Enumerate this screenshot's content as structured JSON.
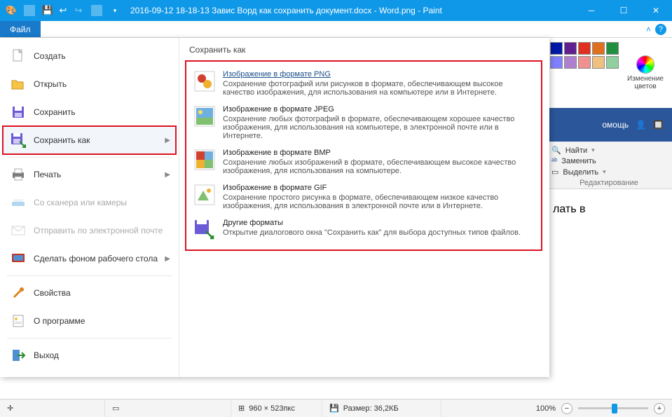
{
  "titlebar": {
    "title": "2016-09-12 18-18-13 Завис Ворд как сохранить документ.docx - Word.png - Paint"
  },
  "tabs": {
    "file": "Файл"
  },
  "ribbon_right": {
    "edit_colors": "Изменение\nцветов",
    "palette": [
      "#000000",
      "#7f7f7f",
      "#880015",
      "#ed1c24",
      "#ff7f27",
      "#ffffff",
      "#c3c3c3",
      "#b97a57",
      "#ffaec9",
      "#ffc90e"
    ]
  },
  "bgword": {
    "tab_help": "омощь",
    "find": "Найти",
    "replace": "Заменить",
    "select": "Выделить",
    "group": "Редактирование",
    "body_fragment": "лать в"
  },
  "filemenu": {
    "items": [
      {
        "label": "Создать",
        "icon": "new"
      },
      {
        "label": "Открыть",
        "icon": "open"
      },
      {
        "label": "Сохранить",
        "icon": "save"
      },
      {
        "label": "Сохранить как",
        "icon": "saveas",
        "selected": true,
        "arrow": true
      },
      {
        "label": "Печать",
        "icon": "print",
        "arrow": true
      },
      {
        "label": "Со сканера или камеры",
        "icon": "scanner",
        "disabled": true
      },
      {
        "label": "Отправить по электронной почте",
        "icon": "email",
        "disabled": true
      },
      {
        "label": "Сделать фоном рабочего стола",
        "icon": "desktop",
        "arrow": true
      },
      {
        "label": "Свойства",
        "icon": "props"
      },
      {
        "label": "О программе",
        "icon": "about"
      },
      {
        "label": "Выход",
        "icon": "exit"
      }
    ],
    "submenu_title": "Сохранить как",
    "options": [
      {
        "title": "Изображение в формате PNG",
        "desc": "Сохранение фотографий или рисунков в формате, обеспечивающем высокое качество изображения, для использования на компьютере или в Интернете."
      },
      {
        "title": "Изображение в формате JPEG",
        "desc": "Сохранение любых фотографий в формате, обеспечивающем хорошее качество изображения, для использования на компьютере, в электронной почте или в Интернете."
      },
      {
        "title": "Изображение в формате BMP",
        "desc": "Сохранение любых изображений в формате, обеспечивающем высокое качество изображения, для использования на компьютере."
      },
      {
        "title": "Изображение в формате GIF",
        "desc": "Сохранение простого рисунка в формате, обеспечивающем низкое качество изображения, для использования в электронной почте или в Интернете."
      },
      {
        "title": "Другие форматы",
        "desc": "Открытие диалогового окна \"Сохранить как\" для выбора доступных типов файлов."
      }
    ]
  },
  "statusbar": {
    "pointer": "",
    "selection": "",
    "canvas_label": "960 × 523пкс",
    "size_label": "Размер: 36,2КБ",
    "zoom": "100%"
  }
}
